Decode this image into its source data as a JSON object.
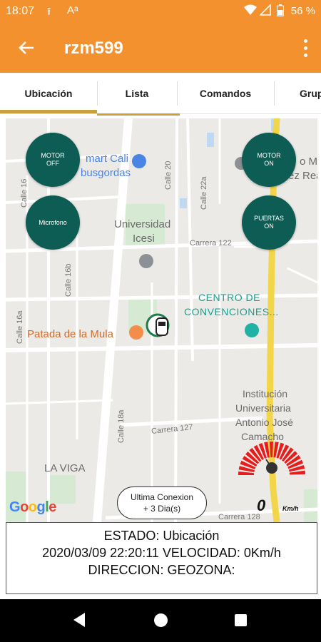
{
  "status_bar": {
    "time": "18:07",
    "battery": "56 %"
  },
  "app_bar": {
    "title": "rzm599"
  },
  "tabs": [
    "Ubicación",
    "Lista",
    "Comandos",
    "Grupos"
  ],
  "map": {
    "labels": {
      "smart_cali": "mart Cali",
      "busgordas": "busgordas",
      "universidad": "Universidad",
      "icesi": "Icesi",
      "centro1": "CENTRO DE",
      "centro2": "CONVENCIONES...",
      "patada": "Patada de la Mula",
      "instucion1": "Institución",
      "instucion2": "Universitaria",
      "instucion3": "Antonio José",
      "instucion4": "Camacho",
      "la_viga": "LA VIGA",
      "mi_right": "o Ma",
      "ez_right": "ez Rea"
    },
    "streets": {
      "carrera_122": "Carrera 122",
      "carrera_127": "Carrera 127",
      "carrera_128": "Carrera 128",
      "calle_20": "Calle 20",
      "calle_22a": "Calle 22a",
      "calle_16": "Calle 16",
      "calle_16b": "Calle 16b",
      "calle_16a": "Calle 16a",
      "calle_18a": "Calle 18a"
    },
    "google_logo": "Google",
    "accent_green": "#0E5D55",
    "route_color": "#F3D54A"
  },
  "controls": {
    "motor_off": [
      "MOTOR",
      "OFF"
    ],
    "motor_on": [
      "MOTOR",
      "ON"
    ],
    "microfono": "Microfono",
    "puertas_on": [
      "PUERTAS",
      "ON"
    ]
  },
  "last_connection": {
    "line1": "Ultima Conexion",
    "line2": "+ 3 Dia(s)"
  },
  "speedometer": {
    "digit": "0",
    "unit": "Km/h"
  },
  "status_panel": {
    "line1": "ESTADO: Ubicación",
    "line2": "2020/03/09 22:20:11 VELOCIDAD: 0Km/h",
    "line3": "DIRECCION:  GEOZONA:"
  }
}
